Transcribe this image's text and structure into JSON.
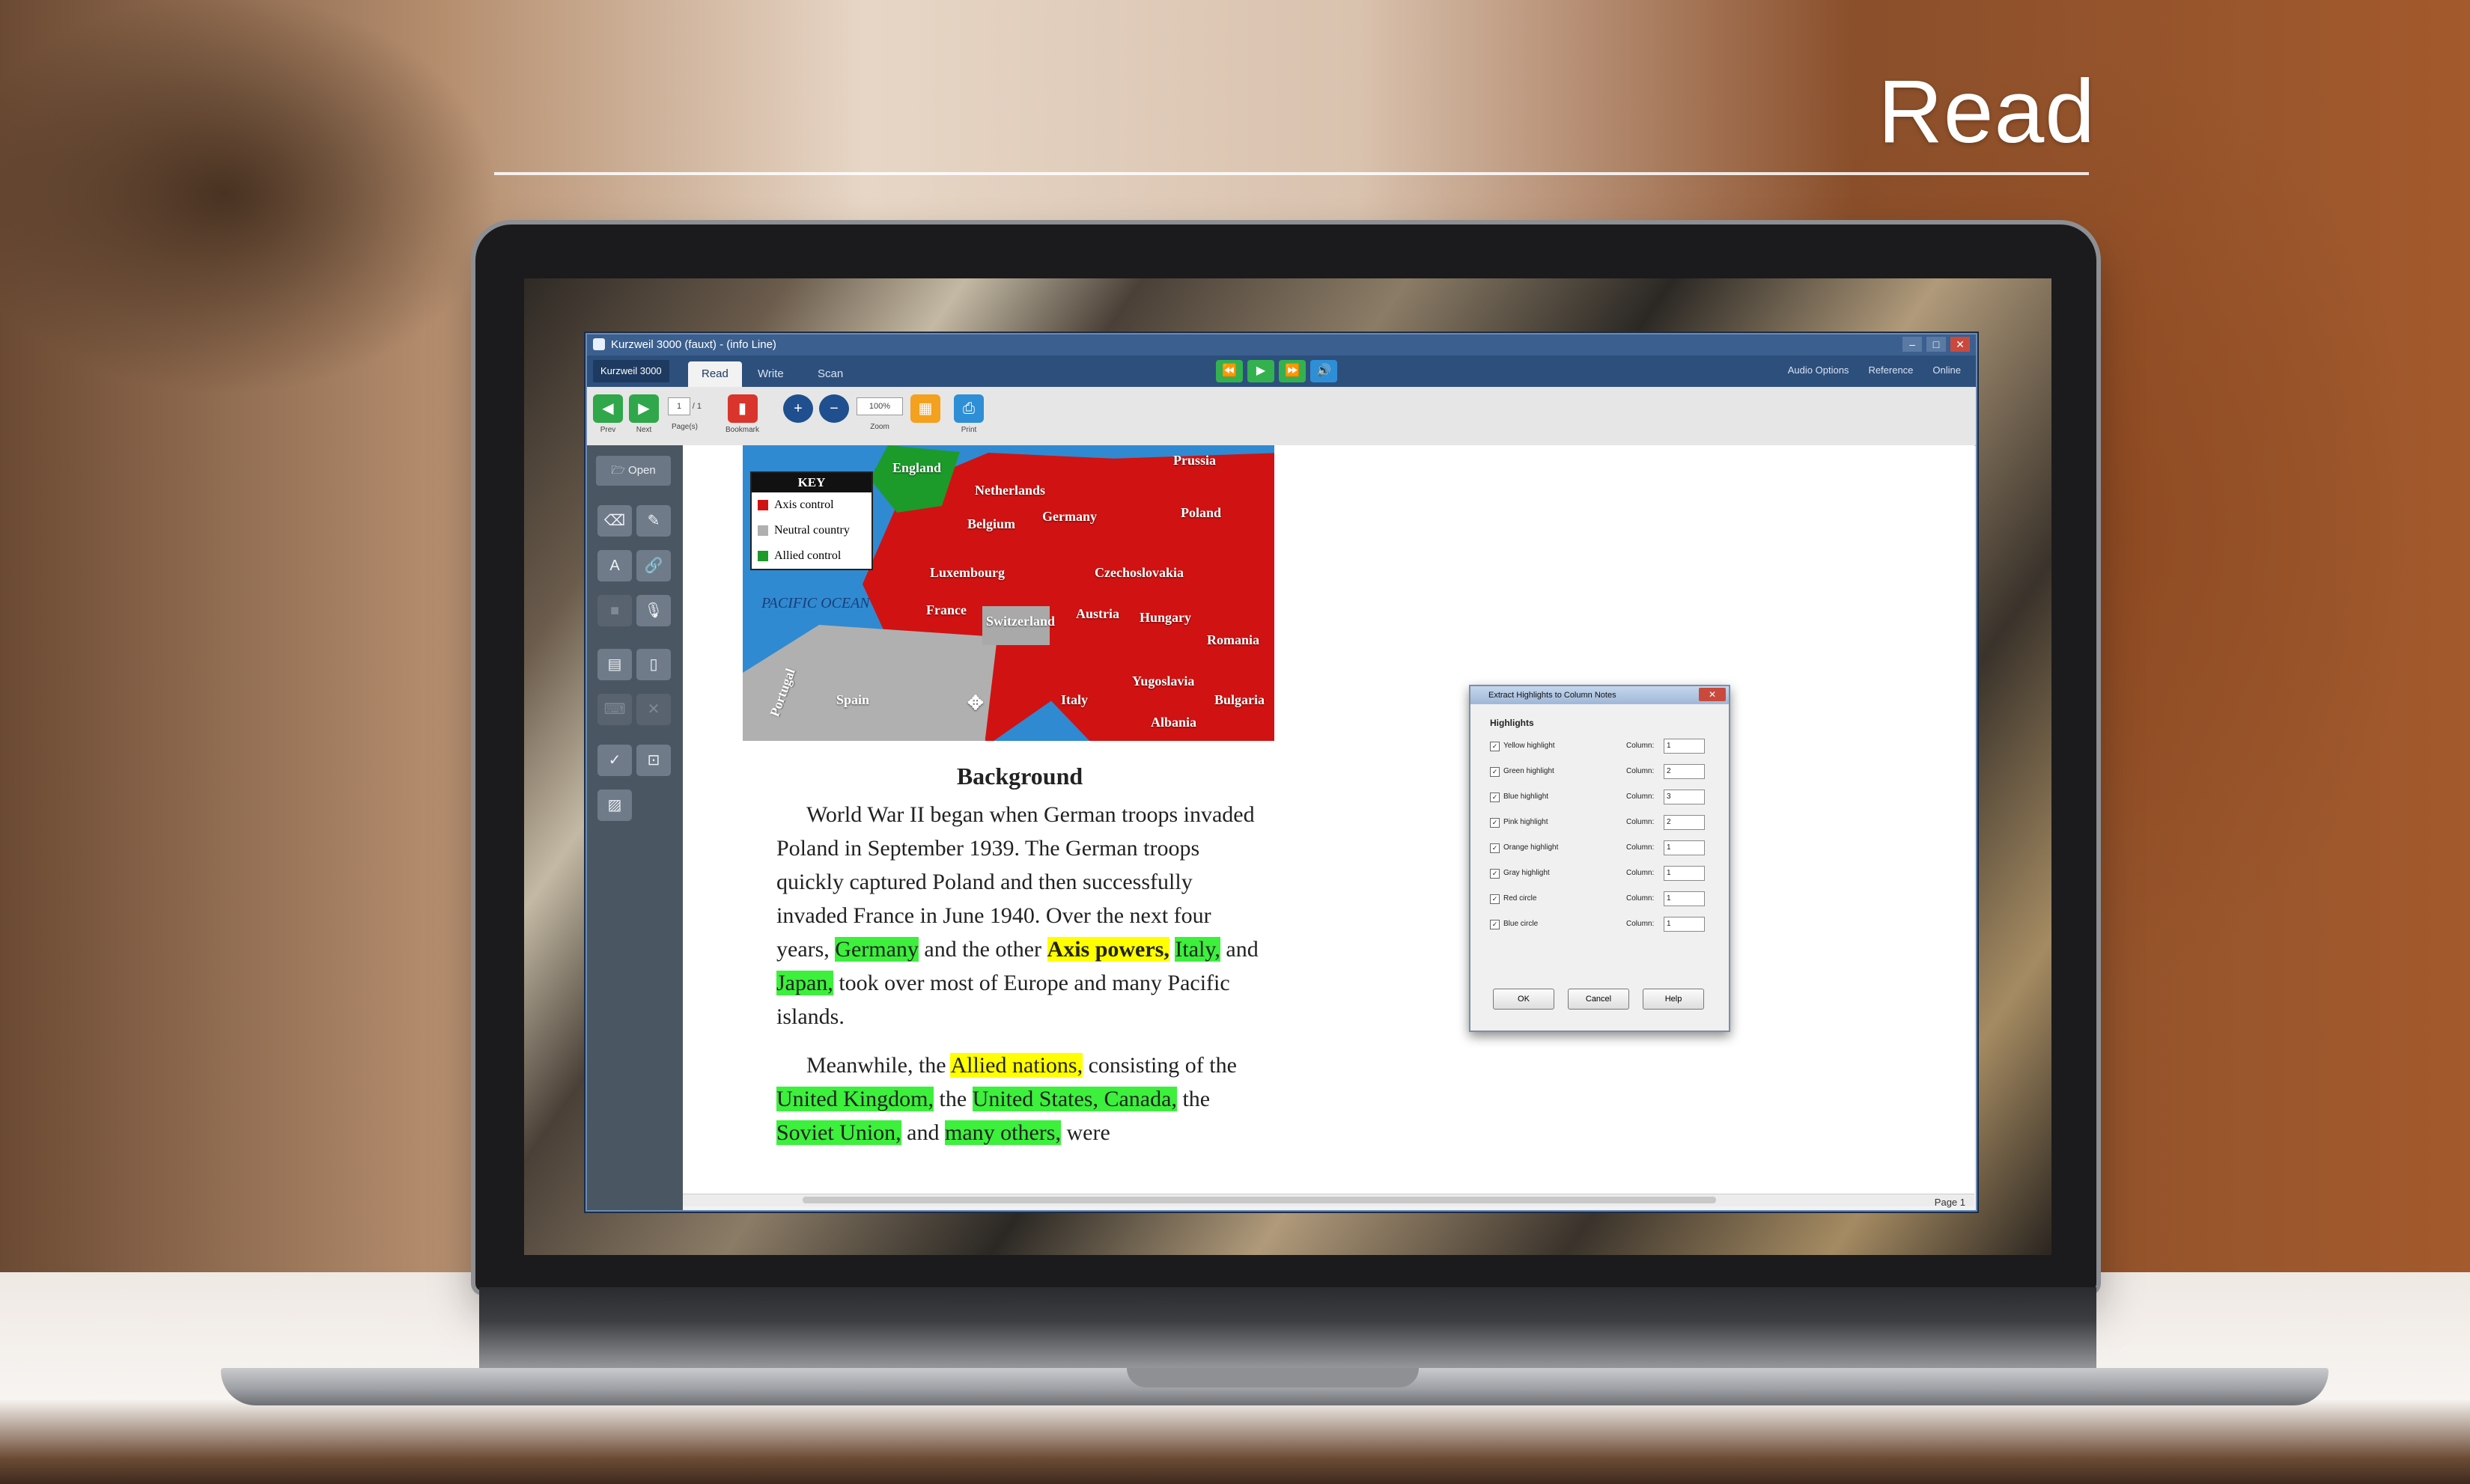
{
  "hero": {
    "title": "Read"
  },
  "window": {
    "title": "Kurzweil 3000 (fauxt) - (info Line)"
  },
  "tabs": {
    "brand": "Kurzweil 3000",
    "read": "Read",
    "write": "Write",
    "scan": "Scan"
  },
  "top_links": {
    "audio": "Audio Options",
    "reference": "Reference",
    "online": "Online"
  },
  "toolbar": {
    "prev": "Prev",
    "next": "Next",
    "pages": "Page(s)",
    "page_value": "1",
    "page_total": "/ 1",
    "bookmark": "Bookmark",
    "zoom": "Zoom",
    "zoom_value": "100%",
    "print": "Print"
  },
  "sidebar": {
    "open": "Open"
  },
  "map": {
    "key_title": "KEY",
    "key_items": [
      "Axis control",
      "Neutral country",
      "Allied control"
    ],
    "key_colors": [
      "#d11212",
      "#b0b0b0",
      "#1c9b2a"
    ],
    "labels": {
      "england": "England",
      "netherlands": "Netherlands",
      "prussia": "Prussia",
      "germany": "Germany",
      "poland": "Poland",
      "belgium": "Belgium",
      "luxembourg": "Luxembourg",
      "czech": "Czechoslovakia",
      "pacific": "PACIFIC OCEAN",
      "france": "France",
      "switzerland": "Switzerland",
      "austria": "Austria",
      "hungary": "Hungary",
      "romania": "Romania",
      "yugoslavia": "Yugoslavia",
      "spain": "Spain",
      "portugal": "Portugal",
      "italy": "Italy",
      "bulgaria": "Bulgaria",
      "albania": "Albania"
    }
  },
  "document": {
    "heading": "Background",
    "p1": {
      "a": "World War II began when German troops invaded Poland in September 1939. The German troops quickly captured Poland and then successfully invaded France in June 1940. Over the next four years, ",
      "germany": "Germany",
      "b": " and the other ",
      "axis": "Axis powers,",
      "c": " ",
      "italy": "Italy,",
      "d": " and ",
      "japan": "Japan,",
      "e": " took over most of Europe and many Pacific islands."
    },
    "p2": {
      "a": "Meanwhile, the ",
      "allied": "Allied nations,",
      "b": " consisting of the ",
      "uk": "United Kingdom,",
      "c": " the ",
      "us": "United States, Canada,",
      "d": " the ",
      "soviet": "Soviet Union,",
      "e": " and ",
      "others": "many others,",
      "f": " were"
    },
    "page_label": "Page 1"
  },
  "dialog": {
    "title": "Extract Highlights to Column Notes",
    "heading": "Highlights",
    "column_label": "Column:",
    "rows": [
      {
        "label": "Yellow highlight",
        "value": "1"
      },
      {
        "label": "Green highlight",
        "value": "2"
      },
      {
        "label": "Blue highlight",
        "value": "3"
      },
      {
        "label": "Pink highlight",
        "value": "2"
      },
      {
        "label": "Orange highlight",
        "value": "1"
      },
      {
        "label": "Gray highlight",
        "value": "1"
      },
      {
        "label": "Red circle",
        "value": "1"
      },
      {
        "label": "Blue circle",
        "value": "1"
      }
    ],
    "ok": "OK",
    "cancel": "Cancel",
    "help": "Help"
  }
}
